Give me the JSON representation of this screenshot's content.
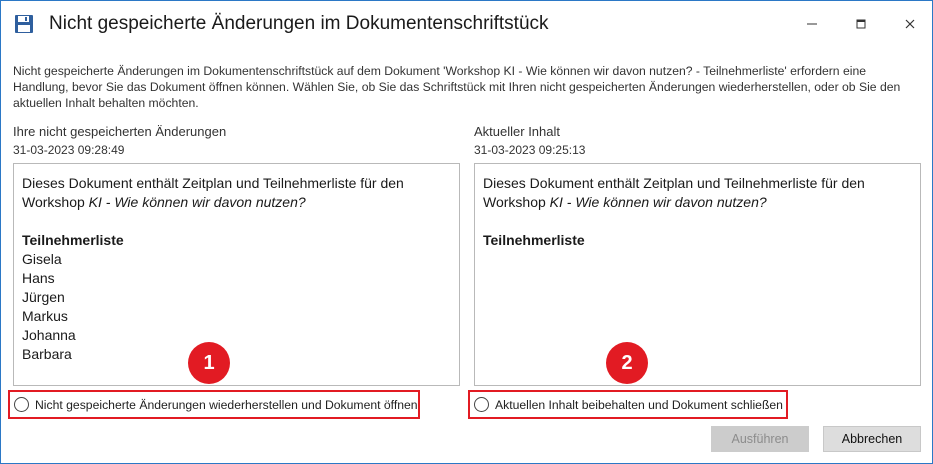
{
  "window": {
    "title": "Nicht gespeicherte Änderungen im Dokumentenschriftstück",
    "controls": {
      "minimize_icon": "minimize-icon",
      "maximize_icon": "maximize-icon",
      "close_icon": "close-icon"
    }
  },
  "intro": "Nicht gespeicherte Änderungen im Dokumentenschriftstück auf dem Dokument 'Workshop KI - Wie können wir davon nutzen? - Teilnehmerliste' erfordern eine Handlung, bevor Sie das Dokument öffnen können. Wählen Sie, ob Sie das Schriftstück mit Ihren nicht gespeicherten Änderungen wiederherstellen, oder ob Sie den aktuellen Inhalt behalten möchten.",
  "left": {
    "heading": "Ihre nicht gespeicherten Änderungen",
    "date": "31-03-2023 09:28:49",
    "content": {
      "line1": "Dieses Dokument enthält Zeitplan und Teilnehmerliste für den",
      "line2_prefix": "Workshop ",
      "line2_italic": "KI - Wie können wir davon nutzen?",
      "list_heading": "Teilnehmerliste",
      "names": [
        "Gisela",
        "Hans",
        "Jürgen",
        "Markus",
        "Johanna",
        "Barbara"
      ]
    },
    "option_label": "Nicht gespeicherte Änderungen wiederherstellen und Dokument öffnen",
    "badge": "1"
  },
  "right": {
    "heading": "Aktueller Inhalt",
    "date": "31-03-2023 09:25:13",
    "content": {
      "line1": "Dieses Dokument enthält Zeitplan und Teilnehmerliste für den",
      "line2_prefix": "Workshop ",
      "line2_italic": "KI - Wie können wir davon nutzen?",
      "list_heading": "Teilnehmerliste"
    },
    "option_label": "Aktuellen Inhalt beibehalten und Dokument schließen",
    "badge": "2"
  },
  "buttons": {
    "execute": "Ausführen",
    "cancel": "Abbrechen"
  },
  "colors": {
    "accent_border": "#2b78c6",
    "highlight_red": "#e21b23",
    "disabled_button": "#cccccc"
  }
}
